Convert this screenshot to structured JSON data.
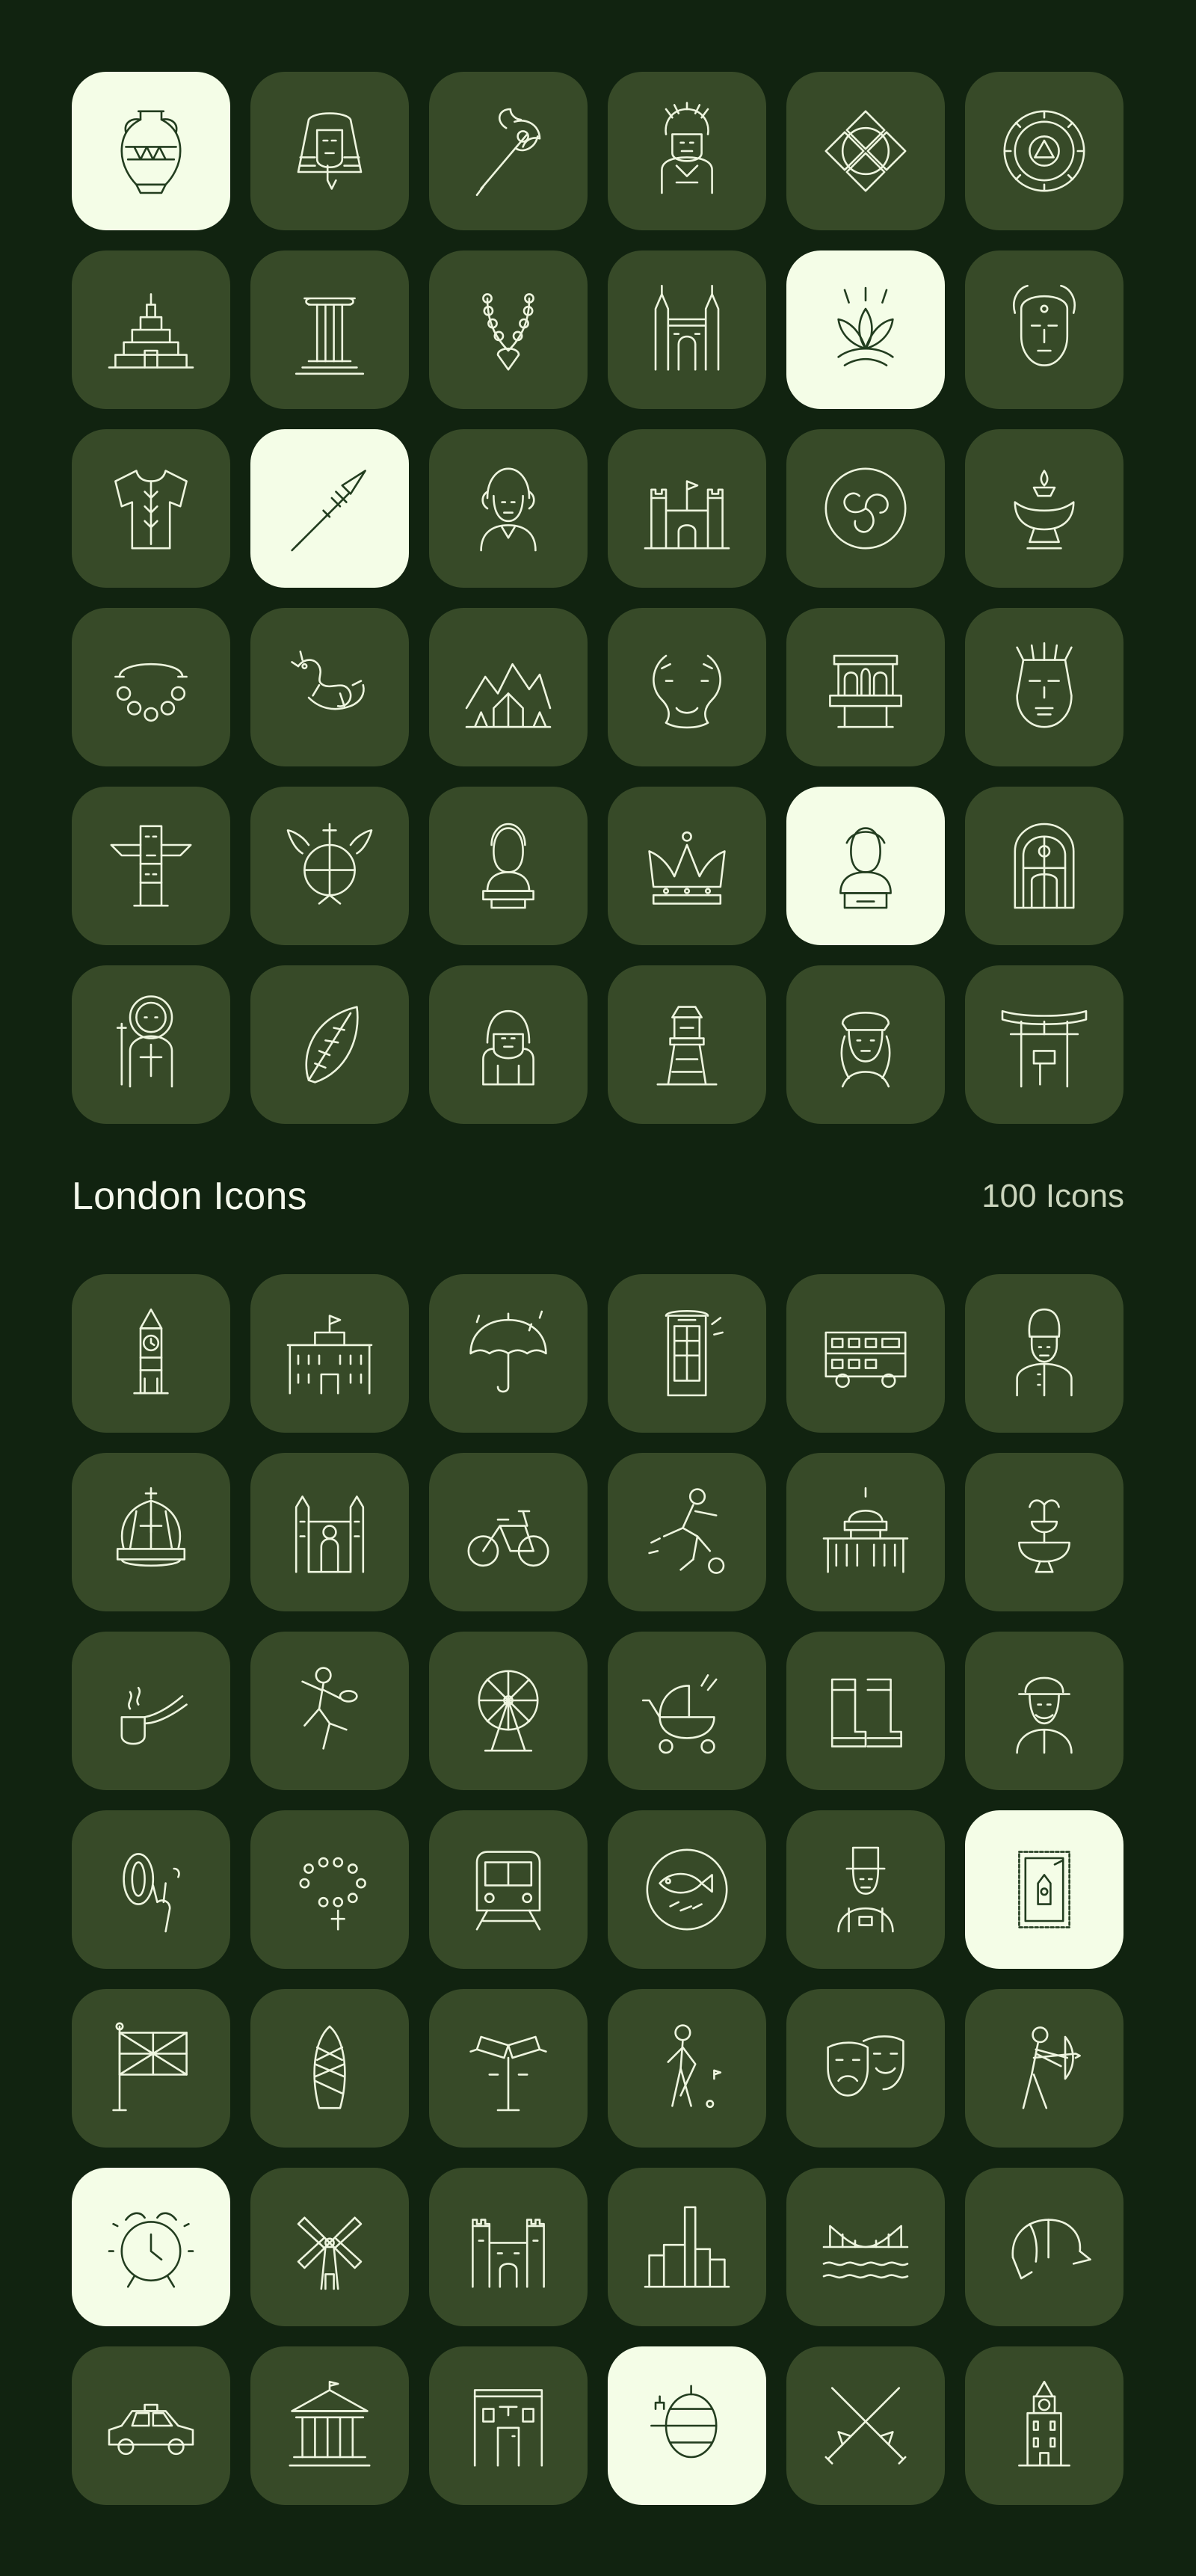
{
  "section": {
    "title": "London Icons",
    "count": "100 Icons"
  },
  "colors": {
    "background": "#112310",
    "tile": "#374a28",
    "tile_highlight": "#f4fde7",
    "line": "#eef5df"
  },
  "culture_icons": [
    {
      "name": "greek-vase-icon",
      "highlighted": true
    },
    {
      "name": "pharaoh-mask-icon",
      "highlighted": false
    },
    {
      "name": "battle-axe-icon",
      "highlighted": false
    },
    {
      "name": "aztec-warrior-icon",
      "highlighted": false
    },
    {
      "name": "celtic-knot-icon",
      "highlighted": false
    },
    {
      "name": "aztec-calendar-icon",
      "highlighted": false
    },
    {
      "name": "step-pyramid-icon",
      "highlighted": false
    },
    {
      "name": "greek-column-icon",
      "highlighted": false
    },
    {
      "name": "shell-necklace-icon",
      "highlighted": false
    },
    {
      "name": "gothic-cathedral-icon",
      "highlighted": false
    },
    {
      "name": "lotus-flower-icon",
      "highlighted": true
    },
    {
      "name": "goddess-mask-icon",
      "highlighted": false
    },
    {
      "name": "embroidered-shirt-icon",
      "highlighted": false
    },
    {
      "name": "spear-icon",
      "highlighted": true
    },
    {
      "name": "wig-gentleman-icon",
      "highlighted": false
    },
    {
      "name": "castle-icon",
      "highlighted": false
    },
    {
      "name": "triskelion-shield-icon",
      "highlighted": false
    },
    {
      "name": "oil-lamp-icon",
      "highlighted": false
    },
    {
      "name": "beaded-bracelet-icon",
      "highlighted": false
    },
    {
      "name": "chinese-dragon-icon",
      "highlighted": false
    },
    {
      "name": "mountain-tent-icon",
      "highlighted": false
    },
    {
      "name": "koi-fish-icon",
      "highlighted": false
    },
    {
      "name": "temple-arches-icon",
      "highlighted": false
    },
    {
      "name": "tribal-mask-icon",
      "highlighted": false
    },
    {
      "name": "totem-pole-icon",
      "highlighted": false
    },
    {
      "name": "viking-shield-icon",
      "highlighted": false
    },
    {
      "name": "bust-sculpture-icon",
      "highlighted": false
    },
    {
      "name": "royal-crown-icon",
      "highlighted": false
    },
    {
      "name": "greek-bust-icon",
      "highlighted": true
    },
    {
      "name": "stained-glass-window-icon",
      "highlighted": false
    },
    {
      "name": "saint-warrior-icon",
      "highlighted": false
    },
    {
      "name": "carved-leaf-icon",
      "highlighted": false
    },
    {
      "name": "sphinx-icon",
      "highlighted": false
    },
    {
      "name": "watchtower-icon",
      "highlighted": false
    },
    {
      "name": "renaissance-man-icon",
      "highlighted": false
    },
    {
      "name": "torii-gate-icon",
      "highlighted": false
    }
  ],
  "london_icons": [
    {
      "name": "big-ben-icon",
      "highlighted": false
    },
    {
      "name": "buckingham-palace-icon",
      "highlighted": false
    },
    {
      "name": "umbrella-rain-icon",
      "highlighted": false
    },
    {
      "name": "phone-booth-icon",
      "highlighted": false
    },
    {
      "name": "double-decker-bus-icon",
      "highlighted": false
    },
    {
      "name": "royal-guard-icon",
      "highlighted": false
    },
    {
      "name": "imperial-crown-icon",
      "highlighted": false
    },
    {
      "name": "westminster-abbey-icon",
      "highlighted": false
    },
    {
      "name": "rental-bicycle-icon",
      "highlighted": false
    },
    {
      "name": "football-player-icon",
      "highlighted": false
    },
    {
      "name": "st-pauls-cathedral-icon",
      "highlighted": false
    },
    {
      "name": "fountain-icon",
      "highlighted": false
    },
    {
      "name": "smoking-pipe-icon",
      "highlighted": false
    },
    {
      "name": "rugby-player-icon",
      "highlighted": false
    },
    {
      "name": "london-eye-icon",
      "highlighted": false
    },
    {
      "name": "baby-pram-icon",
      "highlighted": false
    },
    {
      "name": "rain-boots-icon",
      "highlighted": false
    },
    {
      "name": "bowler-hat-man-icon",
      "highlighted": false
    },
    {
      "name": "tennis-ball-hand-icon",
      "highlighted": false
    },
    {
      "name": "rosary-beads-icon",
      "highlighted": false
    },
    {
      "name": "underground-train-icon",
      "highlighted": false
    },
    {
      "name": "fish-and-chips-icon",
      "highlighted": false
    },
    {
      "name": "top-hat-gentleman-icon",
      "highlighted": false
    },
    {
      "name": "postage-stamp-icon",
      "highlighted": true
    },
    {
      "name": "union-jack-flag-icon",
      "highlighted": false
    },
    {
      "name": "gherkin-tower-icon",
      "highlighted": false
    },
    {
      "name": "cctv-camera-post-icon",
      "highlighted": false
    },
    {
      "name": "golfer-icon",
      "highlighted": false
    },
    {
      "name": "theatre-masks-icon",
      "highlighted": false
    },
    {
      "name": "archer-icon",
      "highlighted": false
    },
    {
      "name": "alarm-clock-icon",
      "highlighted": true
    },
    {
      "name": "windmill-icon",
      "highlighted": false
    },
    {
      "name": "tudor-palace-icon",
      "highlighted": false
    },
    {
      "name": "factory-skyline-icon",
      "highlighted": false
    },
    {
      "name": "bridge-river-icon",
      "highlighted": false
    },
    {
      "name": "deerstalker-hat-icon",
      "highlighted": false
    },
    {
      "name": "london-taxi-icon",
      "highlighted": false
    },
    {
      "name": "british-museum-icon",
      "highlighted": false
    },
    {
      "name": "pub-entrance-icon",
      "highlighted": false
    },
    {
      "name": "beer-barrel-icon",
      "highlighted": true
    },
    {
      "name": "crossed-swords-icon",
      "highlighted": false
    },
    {
      "name": "clock-tower-icon",
      "highlighted": false
    }
  ]
}
